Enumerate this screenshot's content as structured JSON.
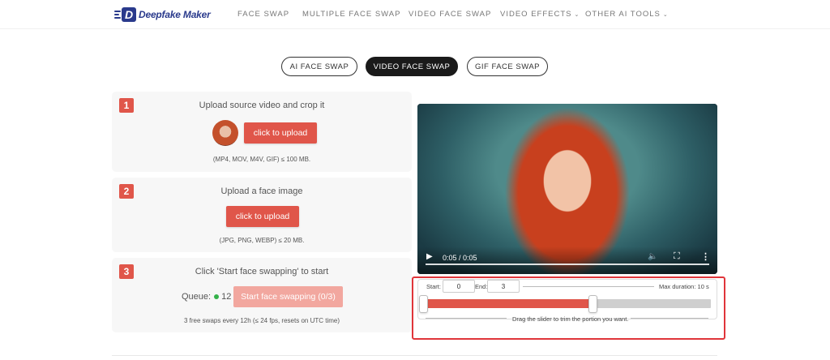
{
  "brand": {
    "name": "Deepfake Maker",
    "mark": "D",
    "color": "#2a3a8c"
  },
  "nav": {
    "items": [
      {
        "label": "FACE SWAP"
      },
      {
        "label": "MULTIPLE FACE SWAP"
      },
      {
        "label": "VIDEO FACE SWAP"
      },
      {
        "label": "VIDEO EFFECTS",
        "dropdown": true
      },
      {
        "label": "OTHER AI TOOLS",
        "dropdown": true
      }
    ]
  },
  "mode_tabs": [
    {
      "label": "AI FACE SWAP",
      "active": false
    },
    {
      "label": "VIDEO FACE SWAP",
      "active": true
    },
    {
      "label": "GIF FACE SWAP",
      "active": false
    }
  ],
  "steps": [
    {
      "num": "1",
      "title": "Upload source video and crop it",
      "button": "click to upload",
      "hint": "(MP4, MOV, M4V, GIF) ≤ 100 MB."
    },
    {
      "num": "2",
      "title": "Upload a face image",
      "button": "click to upload",
      "hint": "(JPG, PNG, WEBP) ≤ 20 MB."
    },
    {
      "num": "3",
      "title": "Click 'Start face swapping' to start",
      "queue_label": "Queue:",
      "queue_count": "12",
      "button": "Start face swapping (0/3)",
      "hint": "3 free swaps every 12h (≤ 24 fps, resets on UTC time)"
    }
  ],
  "player": {
    "time": "0:05 / 0:05",
    "progress": 1.0
  },
  "trim": {
    "start_label": "Start:",
    "start_value": "0",
    "end_label": "End:",
    "end_value": "3",
    "max_duration": "Max duration: 10 s",
    "hint": "Drag the slider to trim the portion you want.",
    "selection_start_fraction": 0.0,
    "selection_end_fraction": 0.59
  },
  "colors": {
    "accent": "#e0564a",
    "accent_disabled": "#f2a79f",
    "highlight": "#e0353a",
    "queue_dot": "#34b24a"
  }
}
